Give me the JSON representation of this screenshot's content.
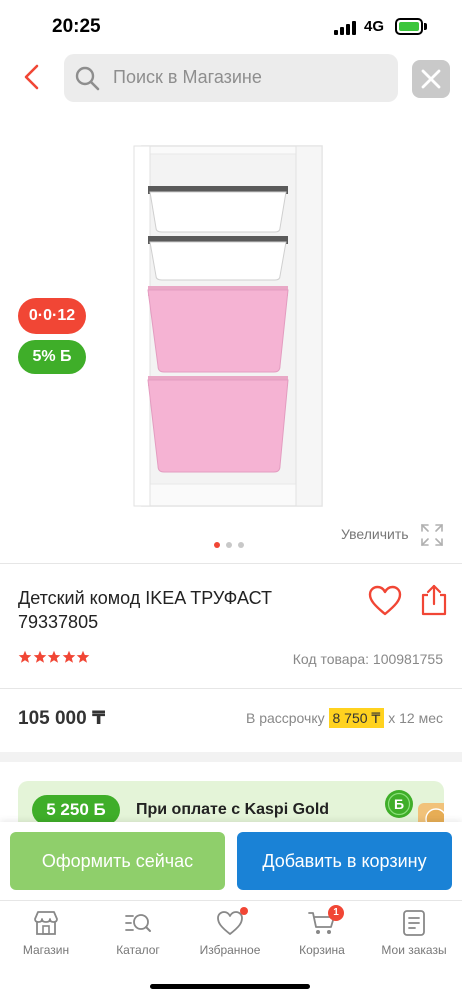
{
  "status_bar": {
    "time": "20:25",
    "network": "4G"
  },
  "header": {
    "search_placeholder": "Поиск в Магазине"
  },
  "gallery": {
    "badge_installment": "0·0·12",
    "badge_bonus": "5% Б",
    "zoom_label": "Увеличить",
    "dots_total": 3,
    "dots_active": 1
  },
  "product": {
    "title": "Детский комод IKEA ТРУФАСТ 79337805",
    "rating_stars": 5,
    "code": "Код товара: 100981755",
    "price": "105 000 ₸",
    "installment_prefix": "В рассрочку",
    "installment_amount": "8 750 ₸",
    "installment_suffix": "х 12 мес"
  },
  "kaspi_gold": {
    "bonus_amount": "5 250 Б",
    "text": "При оплате с Kaspi Gold",
    "coin_letter": "Б"
  },
  "actions": {
    "buy_now": "Оформить сейчас",
    "add_to_cart": "Добавить в корзину"
  },
  "tabs": [
    {
      "label": "Магазин",
      "icon": "store-icon"
    },
    {
      "label": "Каталог",
      "icon": "catalog-icon"
    },
    {
      "label": "Избранное",
      "icon": "heart-icon",
      "dot": true
    },
    {
      "label": "Корзина",
      "icon": "cart-icon",
      "count": "1"
    },
    {
      "label": "Мои заказы",
      "icon": "orders-icon"
    }
  ],
  "colors": {
    "accent_red": "#f14635",
    "bonus_green": "#3fae29",
    "buy_green": "#8fcf6b",
    "cart_blue": "#1a82d6",
    "highlight_yellow": "#ffd21f"
  }
}
